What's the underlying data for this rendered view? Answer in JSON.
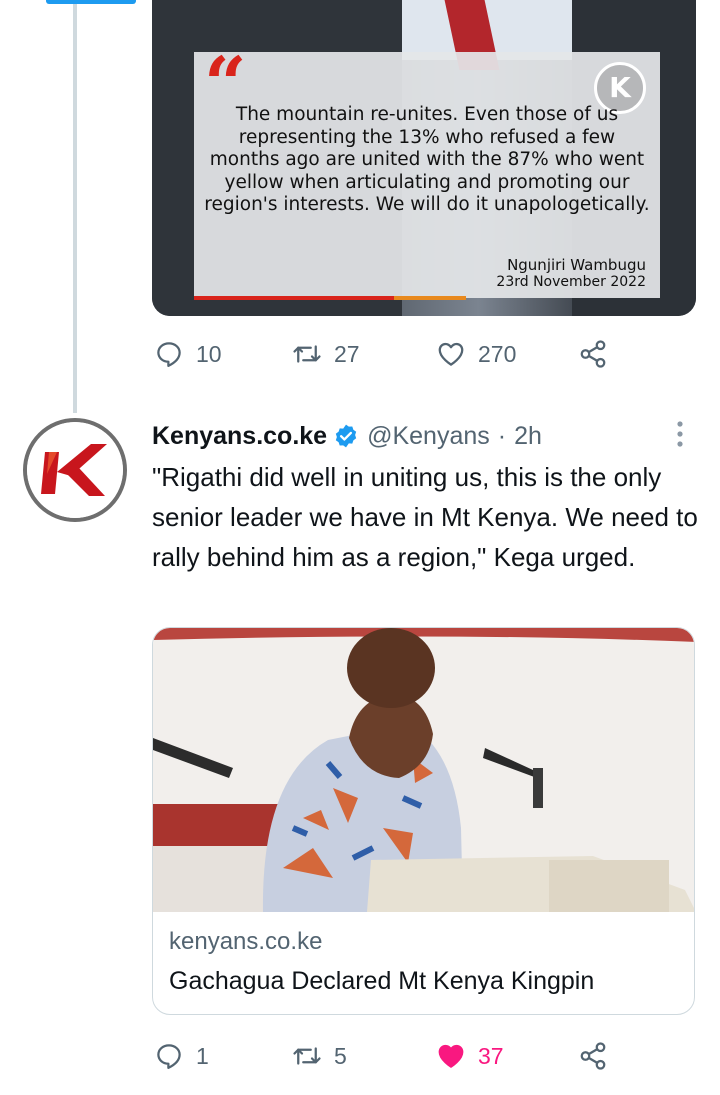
{
  "quote_tweet": {
    "quote_text": "The mountain re-unites. Even those of us representing the 13% who refused a few months ago are united with the 87% who went yellow when articulating and promoting our region's interests. We will do it unapologetically.",
    "quote_author": "Ngunjiri Wambugu",
    "quote_date": "23rd November 2022",
    "badge_letter": "K",
    "quote_mark": "“",
    "actions": {
      "replies": "10",
      "retweets": "27",
      "likes": "270"
    }
  },
  "tweet": {
    "author_name": "Kenyans.co.ke",
    "handle": "@Kenyans",
    "separator": "·",
    "time": "2h",
    "text": "\"Rigathi did well in uniting us, this is the only senior leader we have in Mt Kenya. We need to rally behind him as a region,\" Kega urged.",
    "link_card": {
      "domain": "kenyans.co.ke",
      "title": "Gachagua Declared Mt Kenya Kingpin"
    },
    "actions": {
      "replies": "1",
      "retweets": "5",
      "likes": "37",
      "liked": true
    }
  },
  "colors": {
    "accent_blue": "#1d9bf0",
    "like_pink": "#f91880",
    "secondary_text": "#536471",
    "quote_red": "#d9241b"
  },
  "icons": [
    "reply-icon",
    "retweet-icon",
    "like-icon",
    "share-icon",
    "verified-badge-icon",
    "more-options-icon"
  ]
}
